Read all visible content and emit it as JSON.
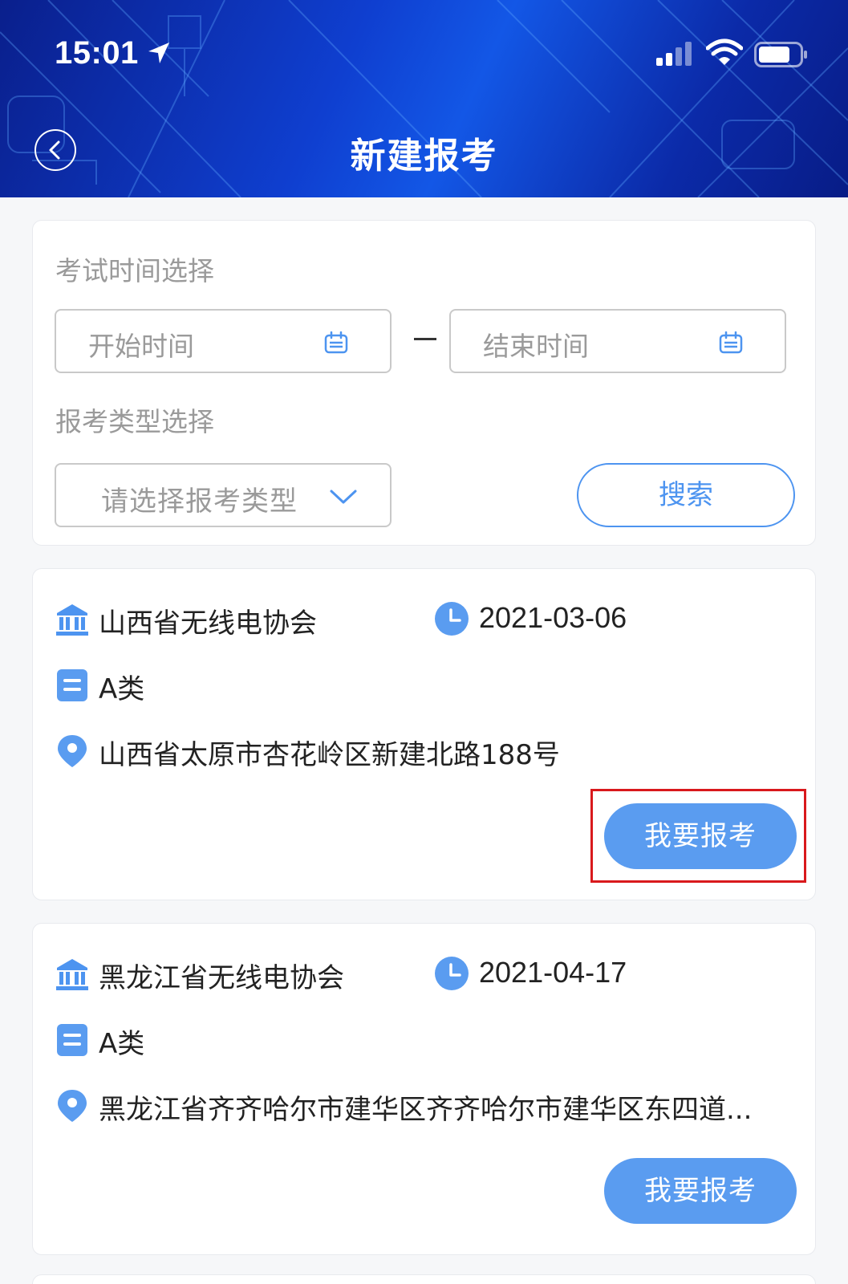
{
  "status_bar": {
    "time": "15:01"
  },
  "header": {
    "title": "新建报考"
  },
  "filters": {
    "exam_time_label": "考试时间选择",
    "start_placeholder": "开始时间",
    "end_placeholder": "结束时间",
    "exam_type_label": "报考类型选择",
    "exam_type_placeholder": "请选择报考类型",
    "search_label": "搜索"
  },
  "exams": [
    {
      "org": "山西省无线电协会",
      "date": "2021-03-06",
      "category": "A类",
      "address": "山西省太原市杏花岭区新建北路188号",
      "apply_label": "我要报考"
    },
    {
      "org": "黑龙江省无线电协会",
      "date": "2021-04-17",
      "category": "A类",
      "address": "黑龙江省齐齐哈尔市建华区齐齐哈尔市建华区东四道...",
      "apply_label": "我要报考"
    }
  ],
  "colors": {
    "accent": "#5a9cf0",
    "header_blue": "#1357e6",
    "highlight": "#d9191c"
  }
}
